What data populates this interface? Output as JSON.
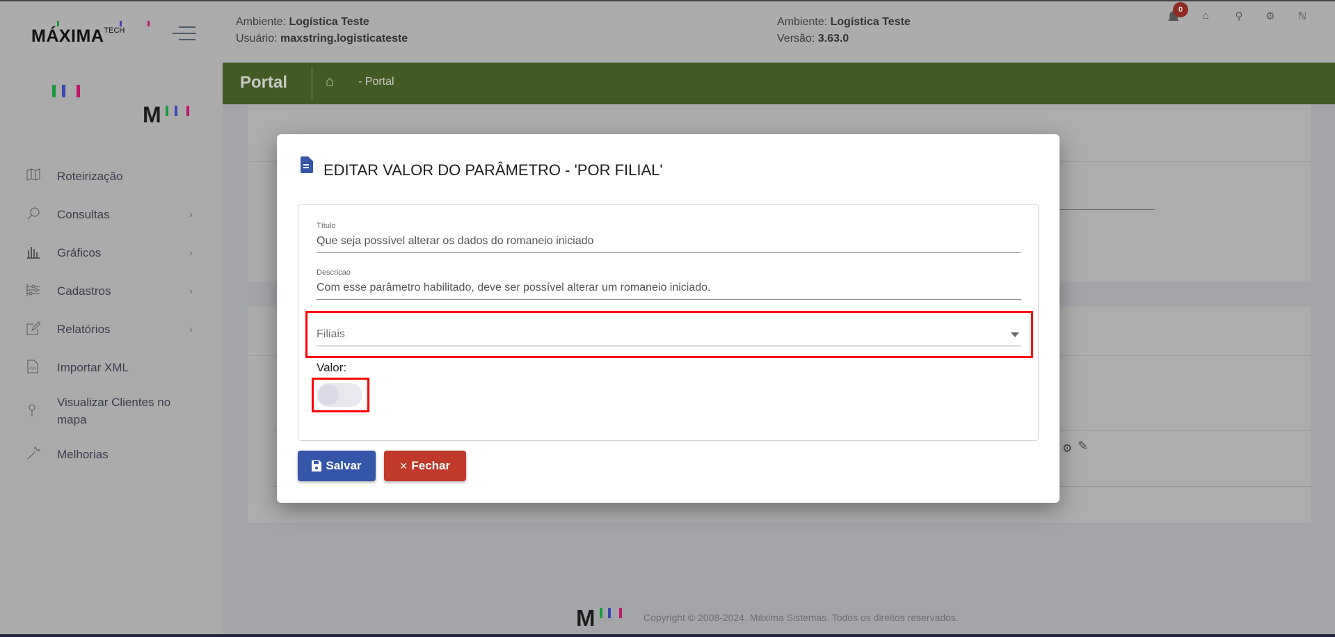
{
  "header": {
    "logo_text": "MÁXIMA TECH",
    "env_label": "Ambiente:",
    "env_value": "Logística Teste",
    "user_label": "Usuário:",
    "user_value": "maxstring.logisticateste",
    "env_label_right": "Ambiente:",
    "env_value_right": "Logística Teste",
    "version_label": "Versão:",
    "version_value": "3.63.0",
    "notification_count": "0",
    "icons": [
      "bell-icon",
      "home-icon",
      "wrench-icon",
      "gear-icon",
      "logout-icon"
    ]
  },
  "breadcrumb": {
    "title": "Portal",
    "path": "- Portal"
  },
  "sidebar": {
    "items": [
      {
        "label": "Roteirização",
        "icon": "map-icon",
        "has_submenu": false
      },
      {
        "label": "Consultas",
        "icon": "search-icon",
        "has_submenu": true
      },
      {
        "label": "Gráficos",
        "icon": "bar-chart-icon",
        "has_submenu": true
      },
      {
        "label": "Cadastros",
        "icon": "sliders-icon",
        "has_submenu": true
      },
      {
        "label": "Relatórios",
        "icon": "edit-icon",
        "has_submenu": true
      },
      {
        "label": "Importar XML",
        "icon": "file-code-icon",
        "has_submenu": false
      },
      {
        "label": "Visualizar Clientes no mapa",
        "icon": "pin-icon",
        "has_submenu": false
      },
      {
        "label": "Melhorias",
        "icon": "magic-wand-icon",
        "has_submenu": false
      }
    ]
  },
  "modal": {
    "title": "EDITAR VALOR DO PARÂMETRO - 'POR FILIAL'",
    "titulo_label": "Título",
    "titulo_value": "Que seja possível alterar os dados do romaneio iniciado",
    "descricao_label": "Descricao",
    "descricao_value": "Com esse parâmetro habilitado, deve ser possível alterar um romaneio iniciado.",
    "filiais_placeholder": "Filiais",
    "valor_label": "Valor:",
    "valor_on": false,
    "save_label": "Salvar",
    "close_label": "Fechar"
  },
  "footer": {
    "copyright": "Copyright © 2008-2024. Máxima Sistemas. Todos os direitos reservados."
  },
  "colors": {
    "brand_green": "#425a25",
    "save": "#3556a8",
    "close": "#c0392b",
    "highlight": "#ff0000"
  }
}
